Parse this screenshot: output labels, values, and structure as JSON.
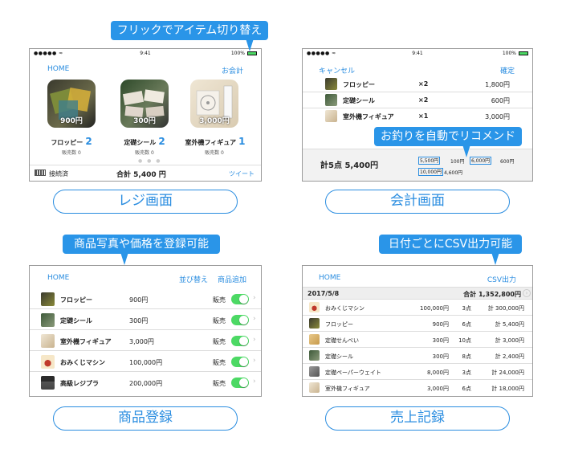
{
  "colors": {
    "accent": "#2a8de0",
    "callout": "#2a95e8",
    "toggle": "#4cd964"
  },
  "callouts": {
    "register": "フリックでアイテム切り替え",
    "checkout": "お釣りを自動でリコメンド",
    "products": "商品写真や価格を登録可能",
    "sales": "日付ごとにCSV出力可能"
  },
  "labels": {
    "register": "レジ画面",
    "checkout": "会計画面",
    "products": "商品登録",
    "sales": "売上記録"
  },
  "status_bar": {
    "carrier": "●●●●● ≈",
    "time": "9:41",
    "battery": "100%"
  },
  "register": {
    "home": "HOME",
    "checkout": "お会計",
    "items": [
      {
        "name": "フロッピー",
        "count": "2",
        "price": "900円",
        "sold": "販売数 0",
        "icon": "floppy-icon"
      },
      {
        "name": "定礎シール",
        "count": "2",
        "price": "300円",
        "sold": "販売数 0",
        "icon": "stone-icon"
      },
      {
        "name": "室外機フィギュア",
        "count": "1",
        "price": "3,000円",
        "sold": "販売数 0",
        "icon": "ac-unit-icon"
      }
    ],
    "connection": "接続済",
    "total": "合計 5,400 円",
    "tweet": "ツイート"
  },
  "checkout": {
    "cancel": "キャンセル",
    "confirm": "確定",
    "lines": [
      {
        "name": "フロッピー",
        "qty": "×2",
        "amount": "1,800円"
      },
      {
        "name": "定礎シール",
        "qty": "×2",
        "amount": "600円"
      },
      {
        "name": "室外機フィギュア",
        "qty": "×1",
        "amount": "3,000円"
      }
    ],
    "summary": "計5点  5,400円",
    "change": [
      {
        "paid": "5,500円",
        "change": "100円"
      },
      {
        "paid": "6,000円",
        "change": "600円"
      },
      {
        "paid": "10,000円",
        "change": "4,600円"
      }
    ]
  },
  "products": {
    "home": "HOME",
    "sort": "並び替え",
    "add": "商品追加",
    "rows": [
      {
        "name": "フロッピー",
        "price": "900円",
        "state": "販売"
      },
      {
        "name": "定礎シール",
        "price": "300円",
        "state": "販売"
      },
      {
        "name": "室外機フィギュア",
        "price": "3,000円",
        "state": "販売"
      },
      {
        "name": "おみくじマシン",
        "price": "100,000円",
        "state": "販売"
      },
      {
        "name": "高級レジプラ",
        "price": "200,000円",
        "state": "販売"
      }
    ]
  },
  "sales": {
    "home": "HOME",
    "csv": "CSV出力",
    "date": "2017/5/8",
    "day_total": "合計 1,352,800円",
    "rows": [
      {
        "name": "おみくじマシン",
        "price": "100,000円",
        "qty": "3点",
        "sum": "計 300,000円"
      },
      {
        "name": "フロッピー",
        "price": "900円",
        "qty": "6点",
        "sum": "計 5,400円"
      },
      {
        "name": "定礎せんべい",
        "price": "300円",
        "qty": "10点",
        "sum": "計 3,000円"
      },
      {
        "name": "定礎シール",
        "price": "300円",
        "qty": "8点",
        "sum": "計 2,400円"
      },
      {
        "name": "定礎ペーパーウェイト",
        "price": "8,000円",
        "qty": "3点",
        "sum": "計 24,000円"
      },
      {
        "name": "室外機フィギュア",
        "price": "3,000円",
        "qty": "6点",
        "sum": "計 18,000円"
      }
    ]
  }
}
